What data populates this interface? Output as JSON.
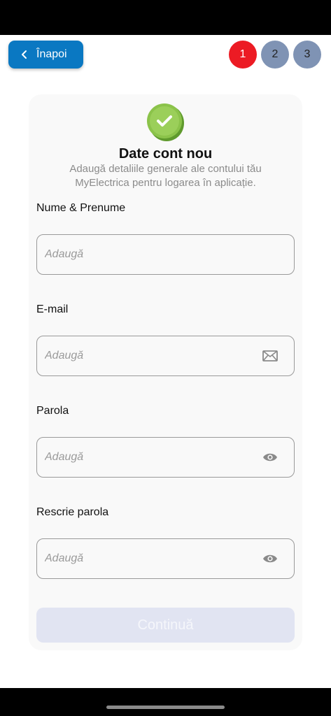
{
  "header": {
    "back_label": "Înapoi",
    "steps": [
      {
        "label": "1",
        "active": true
      },
      {
        "label": "2",
        "active": false
      },
      {
        "label": "3",
        "active": false
      }
    ]
  },
  "form": {
    "title": "Date cont nou",
    "subtitle": "Adaugă detaliile generale ale contului tău MyElectrica pentru logarea în aplicație.",
    "fields": [
      {
        "label": "Nume & Prenume",
        "placeholder": "Adaugă",
        "icon": ""
      },
      {
        "label": "E-mail",
        "placeholder": "Adaugă",
        "icon": "envelope-icon"
      },
      {
        "label": "Parola",
        "placeholder": "Adaugă",
        "icon": "eye-icon"
      },
      {
        "label": "Rescrie parola",
        "placeholder": "Adaugă",
        "icon": "eye-icon"
      }
    ],
    "continue_label": "Continuă"
  },
  "colors": {
    "accent_blue": "#0a78c2",
    "step_active": "#ec1b24",
    "step_inactive": "#7f93b4",
    "success_green": "#8bc34a",
    "button_disabled": "#e1e4f2"
  }
}
